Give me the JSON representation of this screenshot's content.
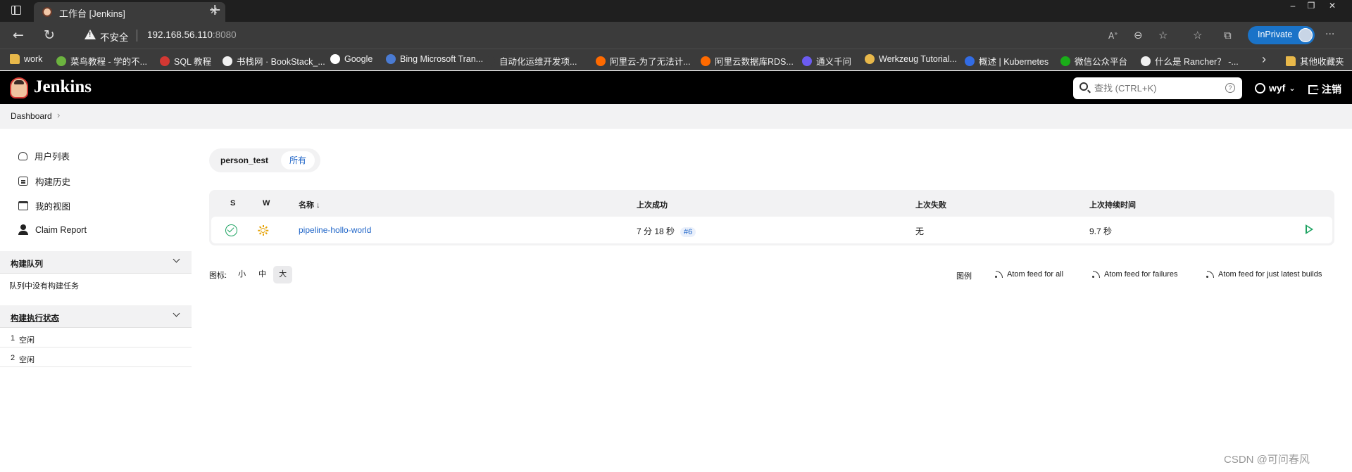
{
  "browser": {
    "tab_title": "工作台 [Jenkins]",
    "tab_close": "✕",
    "tab_new": "+",
    "window_controls": [
      "‒",
      "❐",
      "✕"
    ],
    "insecure_label": "不安全",
    "url_host": "192.168.56.110",
    "url_port": ":8080",
    "inprivate_label": "InPrivate",
    "menu_dots": "···",
    "nav_back": "←",
    "nav_reload": "↻",
    "bookmarks": [
      {
        "label": "work",
        "color": "#e8b84a"
      },
      {
        "label": "菜鸟教程 - 学的不...",
        "color": "#6cb33f"
      },
      {
        "label": "SQL 教程",
        "color": "#d33833"
      },
      {
        "label": "书栈网 · BookStack_...",
        "color": "#f0f0f0"
      },
      {
        "label": "Google",
        "color": "#ffffff"
      },
      {
        "label": "Bing Microsoft Tran...",
        "color": "#4a7bd3"
      },
      {
        "label": "自动化运维开发项...",
        "color": "#3b3b3b"
      },
      {
        "label": "阿里云-为了无法计...",
        "color": "#ff6a00"
      },
      {
        "label": "阿里云数据库RDS...",
        "color": "#ff6a00"
      },
      {
        "label": "通义千问",
        "color": "#6b5bf0"
      },
      {
        "label": "Werkzeug Tutorial...",
        "color": "#e8b84a"
      },
      {
        "label": "概述 | Kubernetes",
        "color": "#326ce5"
      },
      {
        "label": "微信公众平台",
        "color": "#1aad19"
      },
      {
        "label": "什么是 Rancher？ -...",
        "color": "#f0f0f0"
      }
    ],
    "bookmarks_more": "›",
    "other_bookmarks": "其他收藏夹"
  },
  "header": {
    "logo_text": "Jenkins",
    "search_placeholder": "查找 (CTRL+K)",
    "search_help": "?",
    "user_name": "wyf",
    "user_chevron": "⌄",
    "logout_label": "注销"
  },
  "breadcrumb": {
    "items": [
      "Dashboard"
    ],
    "sep": "›"
  },
  "sidebar": {
    "tasks": [
      {
        "label": "用户列表",
        "icon": "users-icon"
      },
      {
        "label": "构建历史",
        "icon": "history-icon"
      },
      {
        "label": "我的视图",
        "icon": "view-icon"
      },
      {
        "label": "Claim Report",
        "icon": "claim-icon"
      }
    ],
    "build_queue": {
      "title": "构建队列",
      "empty_text": "队列中没有构建任务"
    },
    "executors": {
      "title": "构建执行状态",
      "rows": [
        {
          "num": "1",
          "status": "空闲"
        },
        {
          "num": "2",
          "status": "空闲"
        }
      ]
    }
  },
  "views": {
    "tabs": [
      "person_test",
      "所有"
    ],
    "active": "所有"
  },
  "table": {
    "headers": {
      "s": "S",
      "w": "W",
      "name": "名称 ↓",
      "last_success": "上次成功",
      "last_failure": "上次失败",
      "last_duration": "上次持续时间"
    },
    "rows": [
      {
        "name": "pipeline-hollo-world",
        "last_success": "7 分 18 秒",
        "build": "#6",
        "last_failure": "无",
        "last_duration": "9.7 秒",
        "status": "success",
        "weather": "sunny"
      }
    ]
  },
  "icon_size": {
    "label": "图标:",
    "options": [
      "小",
      "中",
      "大"
    ],
    "active": "大"
  },
  "feeds": {
    "legend": "图例",
    "all": "Atom feed for all",
    "failures": "Atom feed for failures",
    "latest": "Atom feed for just latest builds"
  },
  "watermark": "CSDN @可问春风",
  "colors": {
    "accent": "#1f65c8",
    "success": "#1ea362",
    "weather": "#e6a40a",
    "header_bg": "#000000"
  }
}
